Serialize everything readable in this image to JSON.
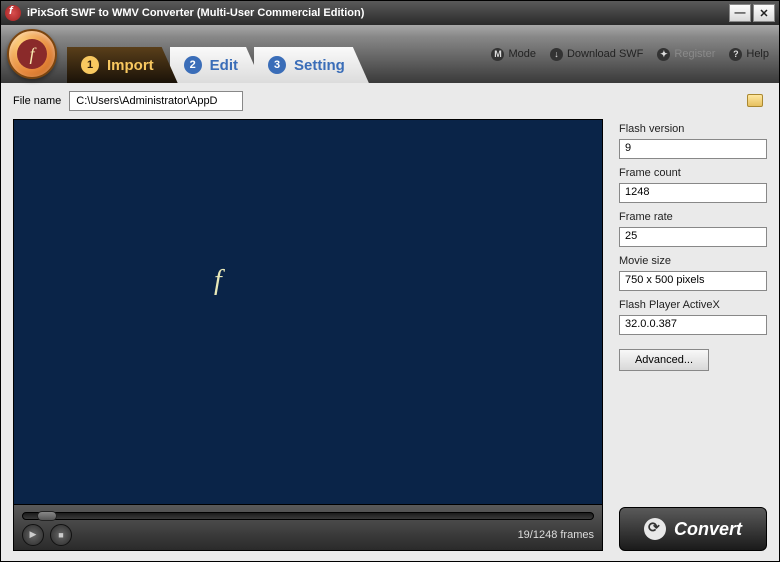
{
  "titlebar": {
    "title": "iPixSoft SWF to WMV Converter (Multi-User Commercial Edition)"
  },
  "tabs": {
    "import": {
      "num": "1",
      "label": "Import"
    },
    "edit": {
      "num": "2",
      "label": "Edit"
    },
    "setting": {
      "num": "3",
      "label": "Setting"
    }
  },
  "header_links": {
    "mode": "Mode",
    "download": "Download SWF",
    "register": "Register",
    "help": "Help"
  },
  "file": {
    "label": "File name",
    "path": "C:\\Users\\Administrator\\AppData\\Roaming\\iPixSoft\\SWF to WMV Converter\\Sample.swf"
  },
  "info": {
    "flash_version": {
      "label": "Flash version",
      "value": "9"
    },
    "frame_count": {
      "label": "Frame count",
      "value": "1248"
    },
    "frame_rate": {
      "label": "Frame rate",
      "value": "25"
    },
    "movie_size": {
      "label": "Movie size",
      "value": "750 x 500 pixels"
    },
    "activex": {
      "label": "Flash Player ActiveX",
      "value": "32.0.0.387"
    }
  },
  "buttons": {
    "advanced": "Advanced...",
    "convert": "Convert"
  },
  "player": {
    "frames": "19/1248 frames"
  }
}
